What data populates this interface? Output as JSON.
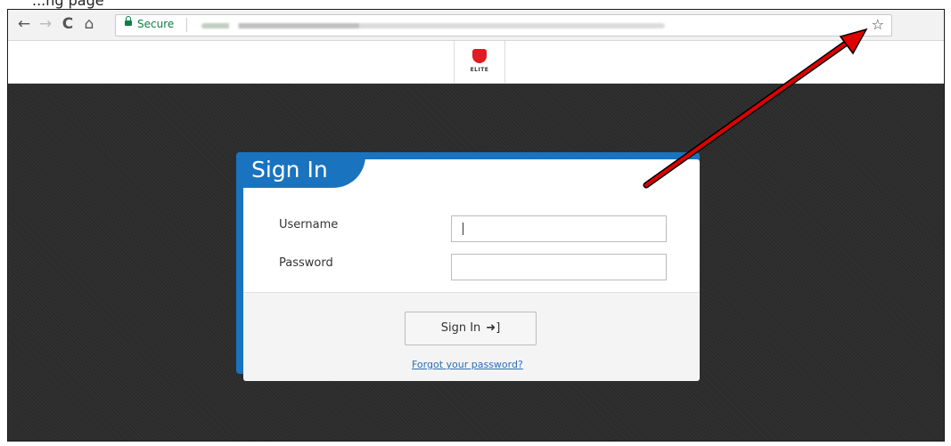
{
  "caption": "...ng page",
  "browser": {
    "secure_label": "Secure",
    "back_icon": "←",
    "forward_icon": "→",
    "reload_icon": "C",
    "home_icon": "⌂",
    "star_icon": "☆"
  },
  "site": {
    "logo_text": "ELITE"
  },
  "login": {
    "title": "Sign In",
    "username_label": "Username",
    "password_label": "Password",
    "username_value": "",
    "password_value": "",
    "submit_label": "Sign In",
    "submit_icon": "➜]",
    "forgot_link": "Forgot your password?"
  },
  "colors": {
    "accent_blue": "#1a73bf",
    "annotation_arrow": "#e00000",
    "logo_red": "#e01b22"
  }
}
